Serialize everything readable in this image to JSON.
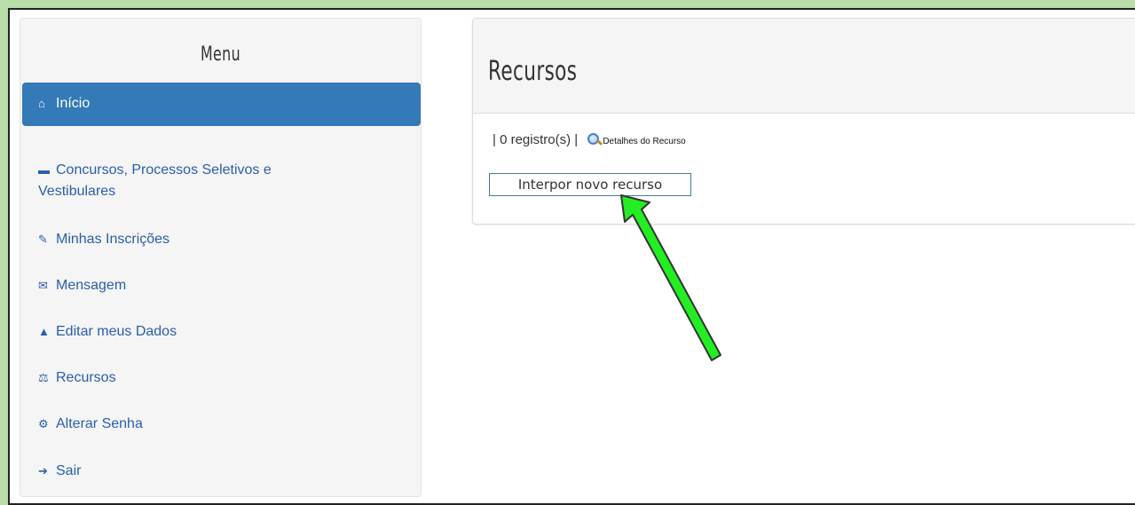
{
  "sidebar": {
    "title": "Menu",
    "items": [
      {
        "label": "Início",
        "icon": "home-icon"
      },
      {
        "label": "Concursos, Processos Seletivos e",
        "label2": "Vestibulares",
        "icon": "folder-icon"
      },
      {
        "label": "Minhas Inscrições",
        "icon": "edit-icon"
      },
      {
        "label": "Mensagem",
        "icon": "envelope-icon"
      },
      {
        "label": "Editar meus Dados",
        "icon": "user-icon"
      },
      {
        "label": "Recursos",
        "icon": "scale-icon"
      },
      {
        "label": "Alterar Senha",
        "icon": "gear-icon"
      },
      {
        "label": "Sair",
        "icon": "sign-out-icon"
      }
    ]
  },
  "main": {
    "title": "Recursos",
    "records_text": "| 0 registro(s) |",
    "details_link": "Detalhes do Recurso",
    "new_button": "Interpor novo recurso"
  },
  "colors": {
    "active_bg": "#337ab7",
    "link": "#2a5ea8",
    "outer_bg": "#b9deaa",
    "arrow": "#22ee22"
  }
}
